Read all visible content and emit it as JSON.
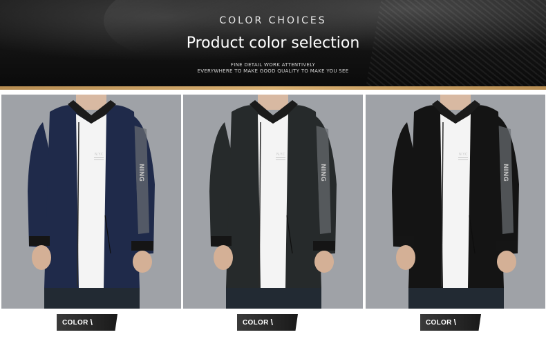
{
  "banner": {
    "kicker": "COLOR CHOICES",
    "headline": "Product color selection",
    "tagline_line1": "FINE DETAIL WORK ATTENTIVELY",
    "tagline_line2": "EVERYWHERE TO MAKE GOOD QUALITY TO MAKE YOU SEE"
  },
  "products": [
    {
      "tag_label": "COLOR",
      "tag_icon": "slash-mark",
      "jacket_color": "#1f2a4a",
      "chest_print": "N.Y.C",
      "sleeve_print": "NING"
    },
    {
      "tag_label": "COLOR",
      "tag_icon": "slash-mark",
      "jacket_color": "#262a2b",
      "chest_print": "N.Y.C",
      "sleeve_print": "NING"
    },
    {
      "tag_label": "COLOR",
      "tag_icon": "slash-mark",
      "jacket_color": "#141414",
      "chest_print": "N.Y.C",
      "sleeve_print": "NING"
    }
  ],
  "colors": {
    "accent_gold": "#c9a064",
    "background_gray": "#9b9ea3"
  }
}
